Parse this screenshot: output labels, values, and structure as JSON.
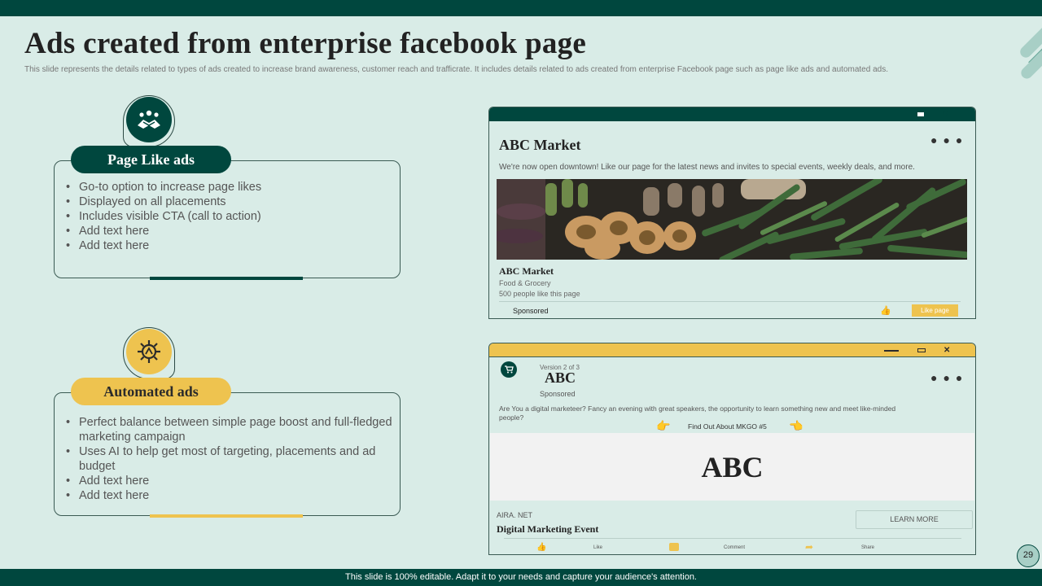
{
  "slide": {
    "title": "Ads created from enterprise facebook page",
    "subtitle": "This slide represents the details related to types of ads created to increase brand awareness, customer reach and trafficrate. It includes details related to ads created from enterprise Facebook page such as page like ads and automated ads.",
    "footer": "This slide is 100% editable.  Adapt it to your needs and capture your audience's attention.",
    "page_number": "29"
  },
  "colors": {
    "dark_green": "#00473e",
    "yellow": "#eec34f",
    "background": "#d9ece7"
  },
  "page_like": {
    "icon": "handshake-icon",
    "label": "Page Like ads",
    "bullets": [
      "Go-to option to increase page likes",
      "Displayed on all placements",
      "Includes visible CTA (call to action)",
      "Add text here",
      "Add text here"
    ]
  },
  "automated": {
    "icon": "gear-icon",
    "label": "Automated ads",
    "bullets": [
      "Perfect balance between simple page boost and full-fledged marketing campaign",
      "Uses AI to help get most of targeting, placements and ad budget",
      "Add text here",
      "Add text here"
    ]
  },
  "ad1": {
    "header": "ABC Market",
    "intro": "We're now open downtown! Like our page for the latest news and invites to special events, weekly deals, and more.",
    "page_name": "ABC Market",
    "category": "Food & Grocery",
    "likes": "500 people like this page",
    "sponsored": "Sponsored",
    "like_button": "Like page"
  },
  "ad2": {
    "version": "Version 2 of 3",
    "brand": "ABC",
    "sponsored": "Sponsored",
    "body": "Are You a digital marketeer? Fancy an evening with great speakers, the opportunity to learn  something new and meet like-minded people?",
    "cta_text": "Find Out About MKGO  #5",
    "banner": "ABC",
    "domain": "AIRA. NET",
    "event_title": "Digital Marketing Event",
    "learn_more": "LEARN MORE",
    "actions": {
      "like": "Like",
      "comment": "Comment",
      "share": "Share"
    }
  }
}
